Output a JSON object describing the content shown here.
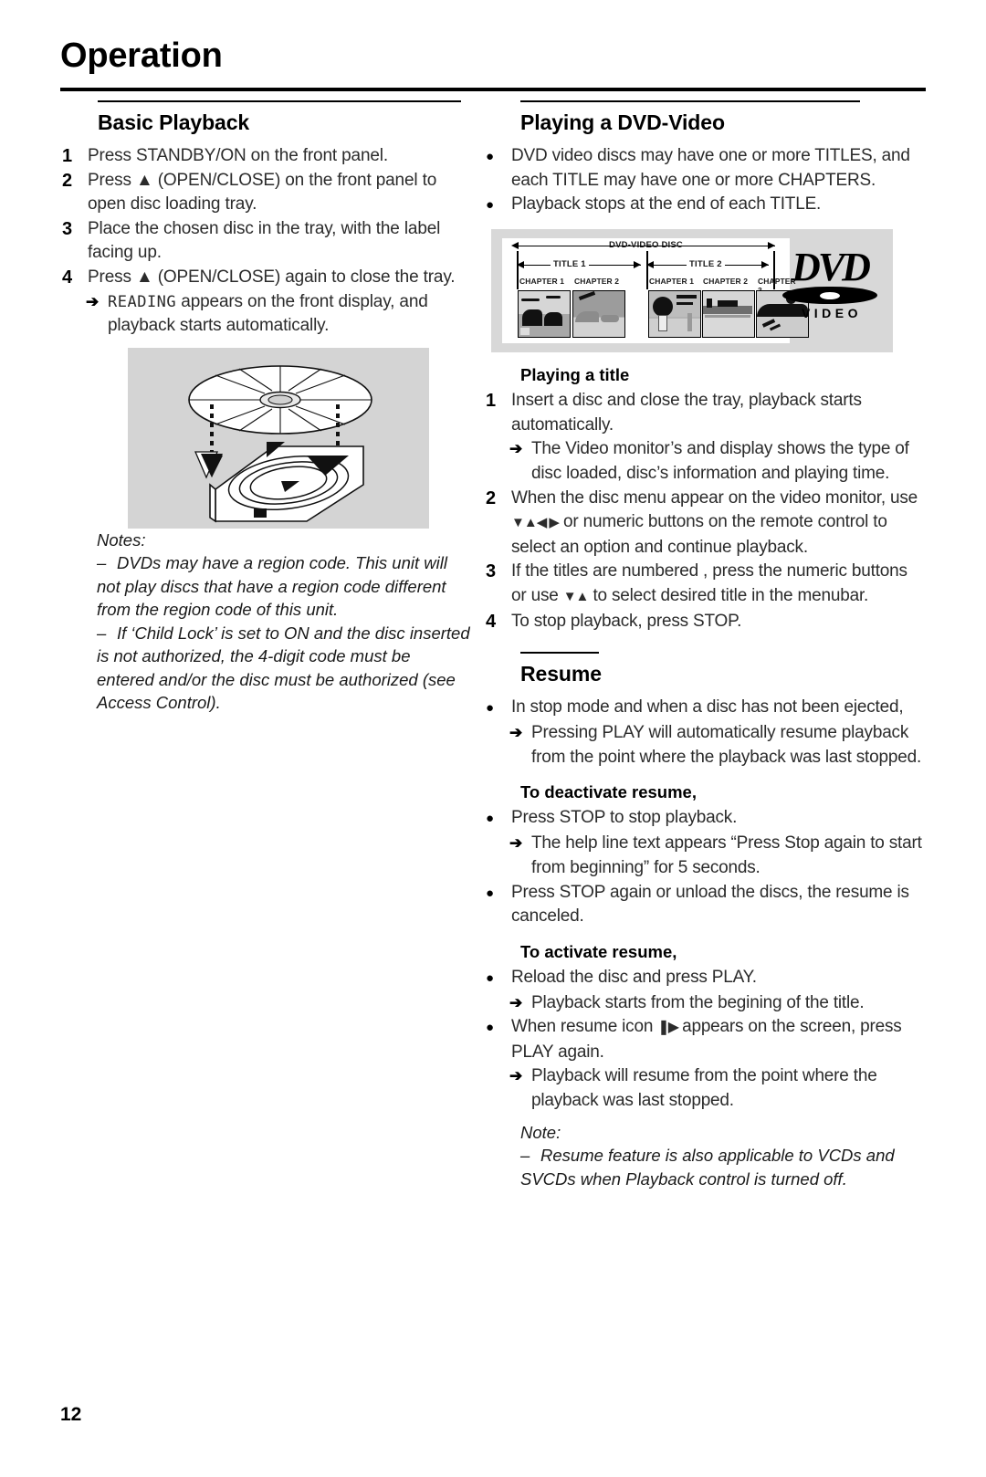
{
  "page": {
    "title": "Operation",
    "number": "12"
  },
  "left_column": {
    "section": {
      "title": "Basic Playback",
      "steps": [
        {
          "num": "1",
          "text": "Press STANDBY/ON on the front panel."
        },
        {
          "num": "2",
          "text": "Press ▲ (OPEN/CLOSE) on the front panel to open disc loading tray."
        },
        {
          "num": "3",
          "text": "Place the chosen disc in the tray, with the label facing up."
        },
        {
          "num": "4",
          "text": "Press ▲ (OPEN/CLOSE) again to close the tray."
        }
      ],
      "step4_sub_arrow": "➔",
      "step4_sub_lcd": "READING",
      "step4_sub_text": " appears on the front display, and playback starts automatically."
    },
    "figure": {
      "caption": "disc-tray-loading-illustration"
    },
    "notes": {
      "label": "Notes:",
      "items": [
        "DVDs may have a region code. This unit will not play discs that have a region code different from the region code of  this unit.",
        "If ‘Child Lock’ is set to ON and the disc inserted is not authorized, the 4-digit code must be entered and/or the disc must be authorized (see Access Control)."
      ],
      "dash": "–"
    }
  },
  "right_column": {
    "section": {
      "title": "Playing a DVD-Video",
      "bullets": [
        "DVD video discs may have one or more TITLES, and each TITLE may have one or more CHAPTERS.",
        "Playback stops at the end of each TITLE."
      ]
    },
    "dvd_diagram": {
      "disc_label": "DVD-VIDEO DISC",
      "titles": [
        "TITLE 1",
        "TITLE 2"
      ],
      "chapters_title1": [
        "CHAPTER 1",
        "CHAPTER 2"
      ],
      "chapters_title2": [
        "CHAPTER 1",
        "CHAPTER 2",
        "CHAPTER 3"
      ],
      "logo_word": "DVD",
      "logo_sub": "VIDEO"
    },
    "playing_title": {
      "title": "Playing a title",
      "steps": [
        {
          "num": "1",
          "text": "Insert a disc and close the tray, playback starts automatically.",
          "sub_arrow": "➔",
          "sub_text": "The Video monitor’s and display shows the type of disc loaded, disc’s information and playing time."
        },
        {
          "num": "2",
          "text_a": "When the disc menu appear on the video monitor, use ",
          "arrows": "▼▲◀ ▶",
          "text_b": " or numeric buttons on the remote control to select an option and continue playback."
        },
        {
          "num": "3",
          "text_a": "If the titles are numbered , press the numeric buttons or use ",
          "arrows": "▼▲",
          "text_b": " to select desired title in the menubar."
        },
        {
          "num": "4",
          "text": "To stop playback, press STOP."
        }
      ]
    },
    "resume": {
      "title": "Resume",
      "bullet_1": "In stop mode and when a disc has not been ejected,",
      "bullet_1_arrow": "➔",
      "bullet_1_sub": "Pressing PLAY will automatically resume playback from the point where the playback was last stopped.",
      "deactivate": {
        "title": "To deactivate resume,",
        "bullet_1": "Press STOP to stop playback.",
        "bullet_1_arrow": "➔",
        "bullet_1_sub": "The help line text appears “Press Stop again to start from beginning” for 5 seconds.",
        "bullet_2": "Press STOP again or unload the discs, the resume is canceled."
      },
      "activate": {
        "title": "To activate resume,",
        "bullet_1": "Reload the disc and press PLAY.",
        "bullet_1_arrow": "➔",
        "bullet_1_sub": "Playback starts from the begining of the title.",
        "bullet_2_a": "When resume icon ",
        "bullet_2_icon": "❚▶",
        "bullet_2_b": " appears on the screen, press PLAY again.",
        "bullet_2_arrow": "➔",
        "bullet_2_sub": "Playback will resume from the point where the playback was last stopped."
      },
      "note": {
        "label": "Note:",
        "dash": "–",
        "text": "Resume feature is also applicable to VCDs and SVCDs when Playback control is turned off."
      }
    },
    "bullet_glyph": "●"
  }
}
